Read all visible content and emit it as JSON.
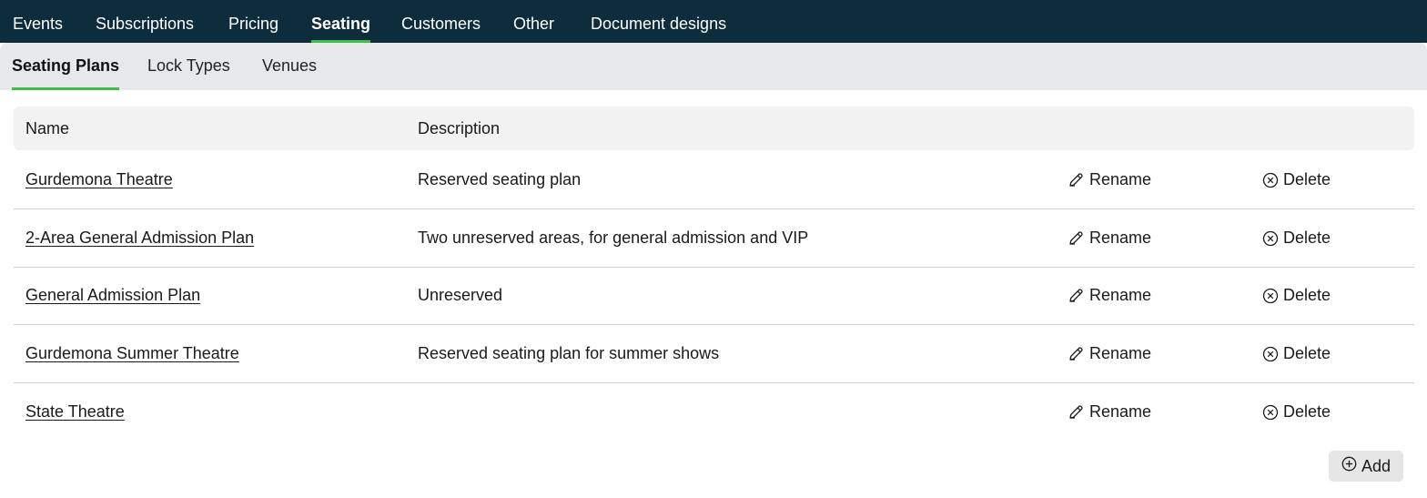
{
  "top_tabs": [
    {
      "label": "Events"
    },
    {
      "label": "Subscriptions"
    },
    {
      "label": "Pricing"
    },
    {
      "label": "Seating",
      "active": true
    },
    {
      "label": "Customers"
    },
    {
      "label": "Other"
    },
    {
      "label": "Document designs"
    }
  ],
  "sub_tabs": [
    {
      "label": "Seating Plans",
      "active": true
    },
    {
      "label": "Lock Types"
    },
    {
      "label": "Venues"
    }
  ],
  "table": {
    "headers": {
      "name": "Name",
      "description": "Description"
    },
    "rename_label": "Rename",
    "delete_label": "Delete",
    "rows": [
      {
        "name": "Gurdemona Theatre",
        "description": "Reserved seating plan"
      },
      {
        "name": "2-Area General Admission Plan",
        "description": "Two unreserved areas, for general admission and VIP"
      },
      {
        "name": "General Admission Plan",
        "description": "Unreserved"
      },
      {
        "name": "Gurdemona Summer Theatre",
        "description": "Reserved seating plan for summer shows"
      },
      {
        "name": "State Theatre",
        "description": ""
      }
    ]
  },
  "add_button": {
    "label": "Add"
  },
  "colors": {
    "topbar": "#0d2d3c",
    "accent": "#3cc04a",
    "subbar": "#e6e8ea"
  },
  "icons": {
    "rename": "pencil-icon",
    "delete": "circle-x-icon",
    "add": "circle-plus-icon"
  }
}
